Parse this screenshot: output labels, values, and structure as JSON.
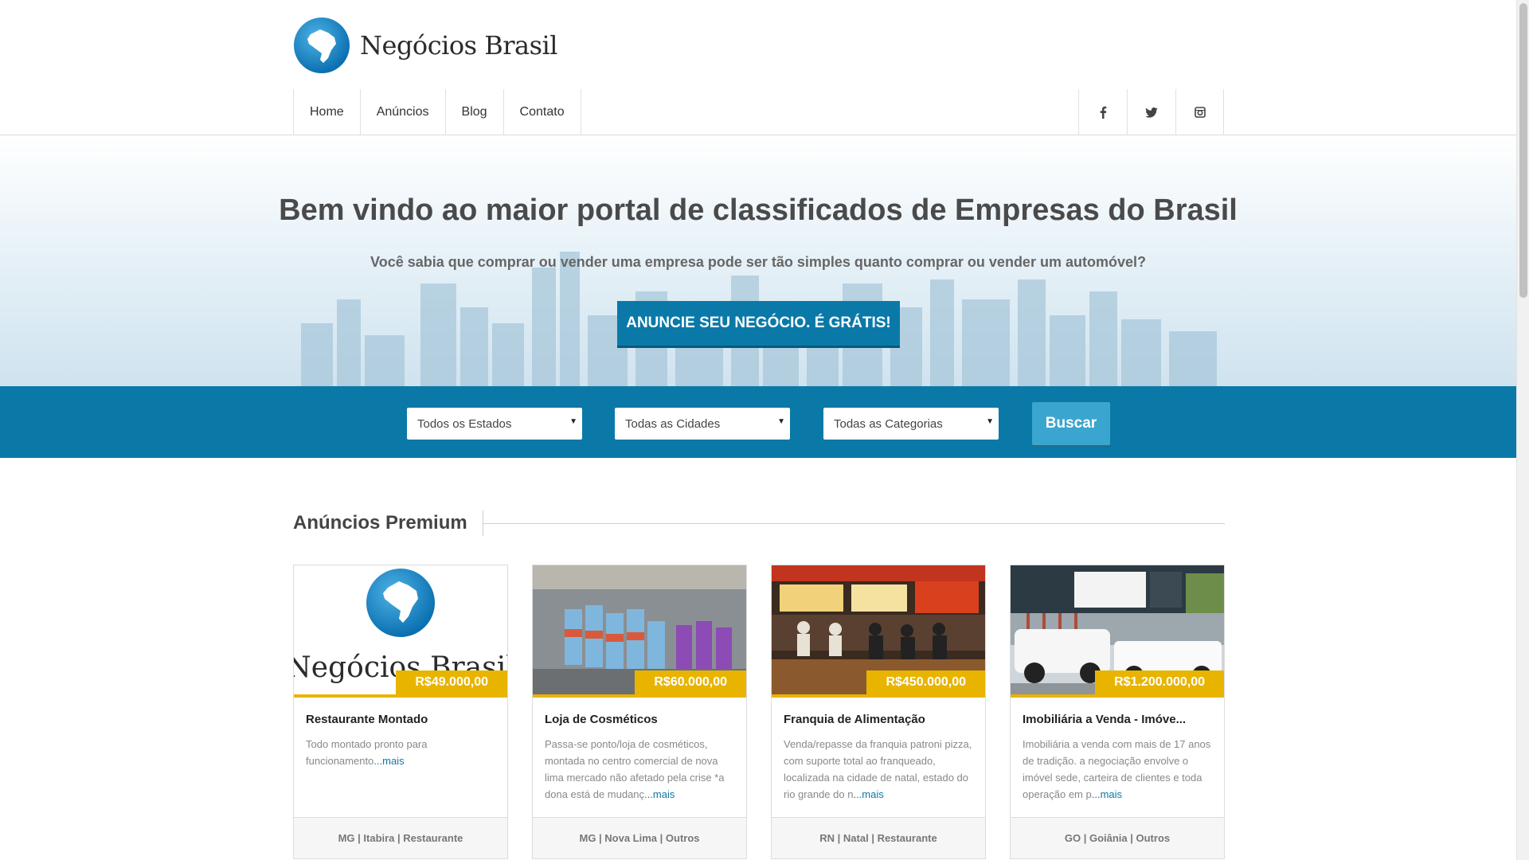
{
  "brand": {
    "name": "Negócios Brasil"
  },
  "nav": {
    "items": [
      {
        "label": "Home"
      },
      {
        "label": "Anúncios"
      },
      {
        "label": "Blog"
      },
      {
        "label": "Contato"
      }
    ],
    "social": [
      {
        "icon": "facebook-icon",
        "glyph": "f"
      },
      {
        "icon": "twitter-icon",
        "glyph": "🐦"
      },
      {
        "icon": "instagram-icon",
        "glyph": "◎"
      }
    ]
  },
  "hero": {
    "title": "Bem vindo ao maior portal de classificados de Empresas do Brasil",
    "subtitle": "Você sabia que comprar ou vender uma empresa pode ser tão simples quanto comprar ou vender um automóvel?",
    "cta": "ANUNCIE SEU NEGÓCIO. É GRÁTIS!"
  },
  "search": {
    "estado": "Todos os Estados",
    "cidade": "Todas as Cidades",
    "categoria": "Todas as Categorias",
    "button": "Buscar"
  },
  "premium": {
    "title": "Anúncios Premium",
    "more_label": "...mais",
    "cards": [
      {
        "price": "R$49.000,00",
        "title": "Restaurante Montado",
        "desc": "Todo montado pronto para funcionamento",
        "footer": "MG | Itabira | Restaurante",
        "image": "negocios-brasil-logo"
      },
      {
        "price": "R$60.000,00",
        "title": "Loja de Cosméticos",
        "desc": "Passa-se ponto/loja de cosméticos, montada no centro comercial de nova lima mercado não afetado pela crise *a dona está de mudanç",
        "footer": "MG | Nova Lima | Outros",
        "image": "cosmetics-shelf-photo"
      },
      {
        "price": "R$450.000,00",
        "title": "Franquia de Alimentação",
        "desc": "Venda/repasse da franquia patroni pizza, com suporte total ao franqueado, localizada na cidade de natal, estado do rio grande do n",
        "footer": "RN | Natal | Restaurante",
        "image": "pizzeria-counter-photo"
      },
      {
        "price": "R$1.200.000,00",
        "title": "Imobiliária a Venda - Imóve...",
        "desc": "Imobiliária a venda com mais de 17 anos de tradição. a negociação envolve o imóvel sede, carteira de clientes e toda operação em p",
        "footer": "GO | Goiânia | Outros",
        "image": "real-estate-office-photo"
      }
    ]
  },
  "colors": {
    "primary": "#0a79a8",
    "accent": "#e8b400",
    "button_light": "#3aa6cf"
  }
}
